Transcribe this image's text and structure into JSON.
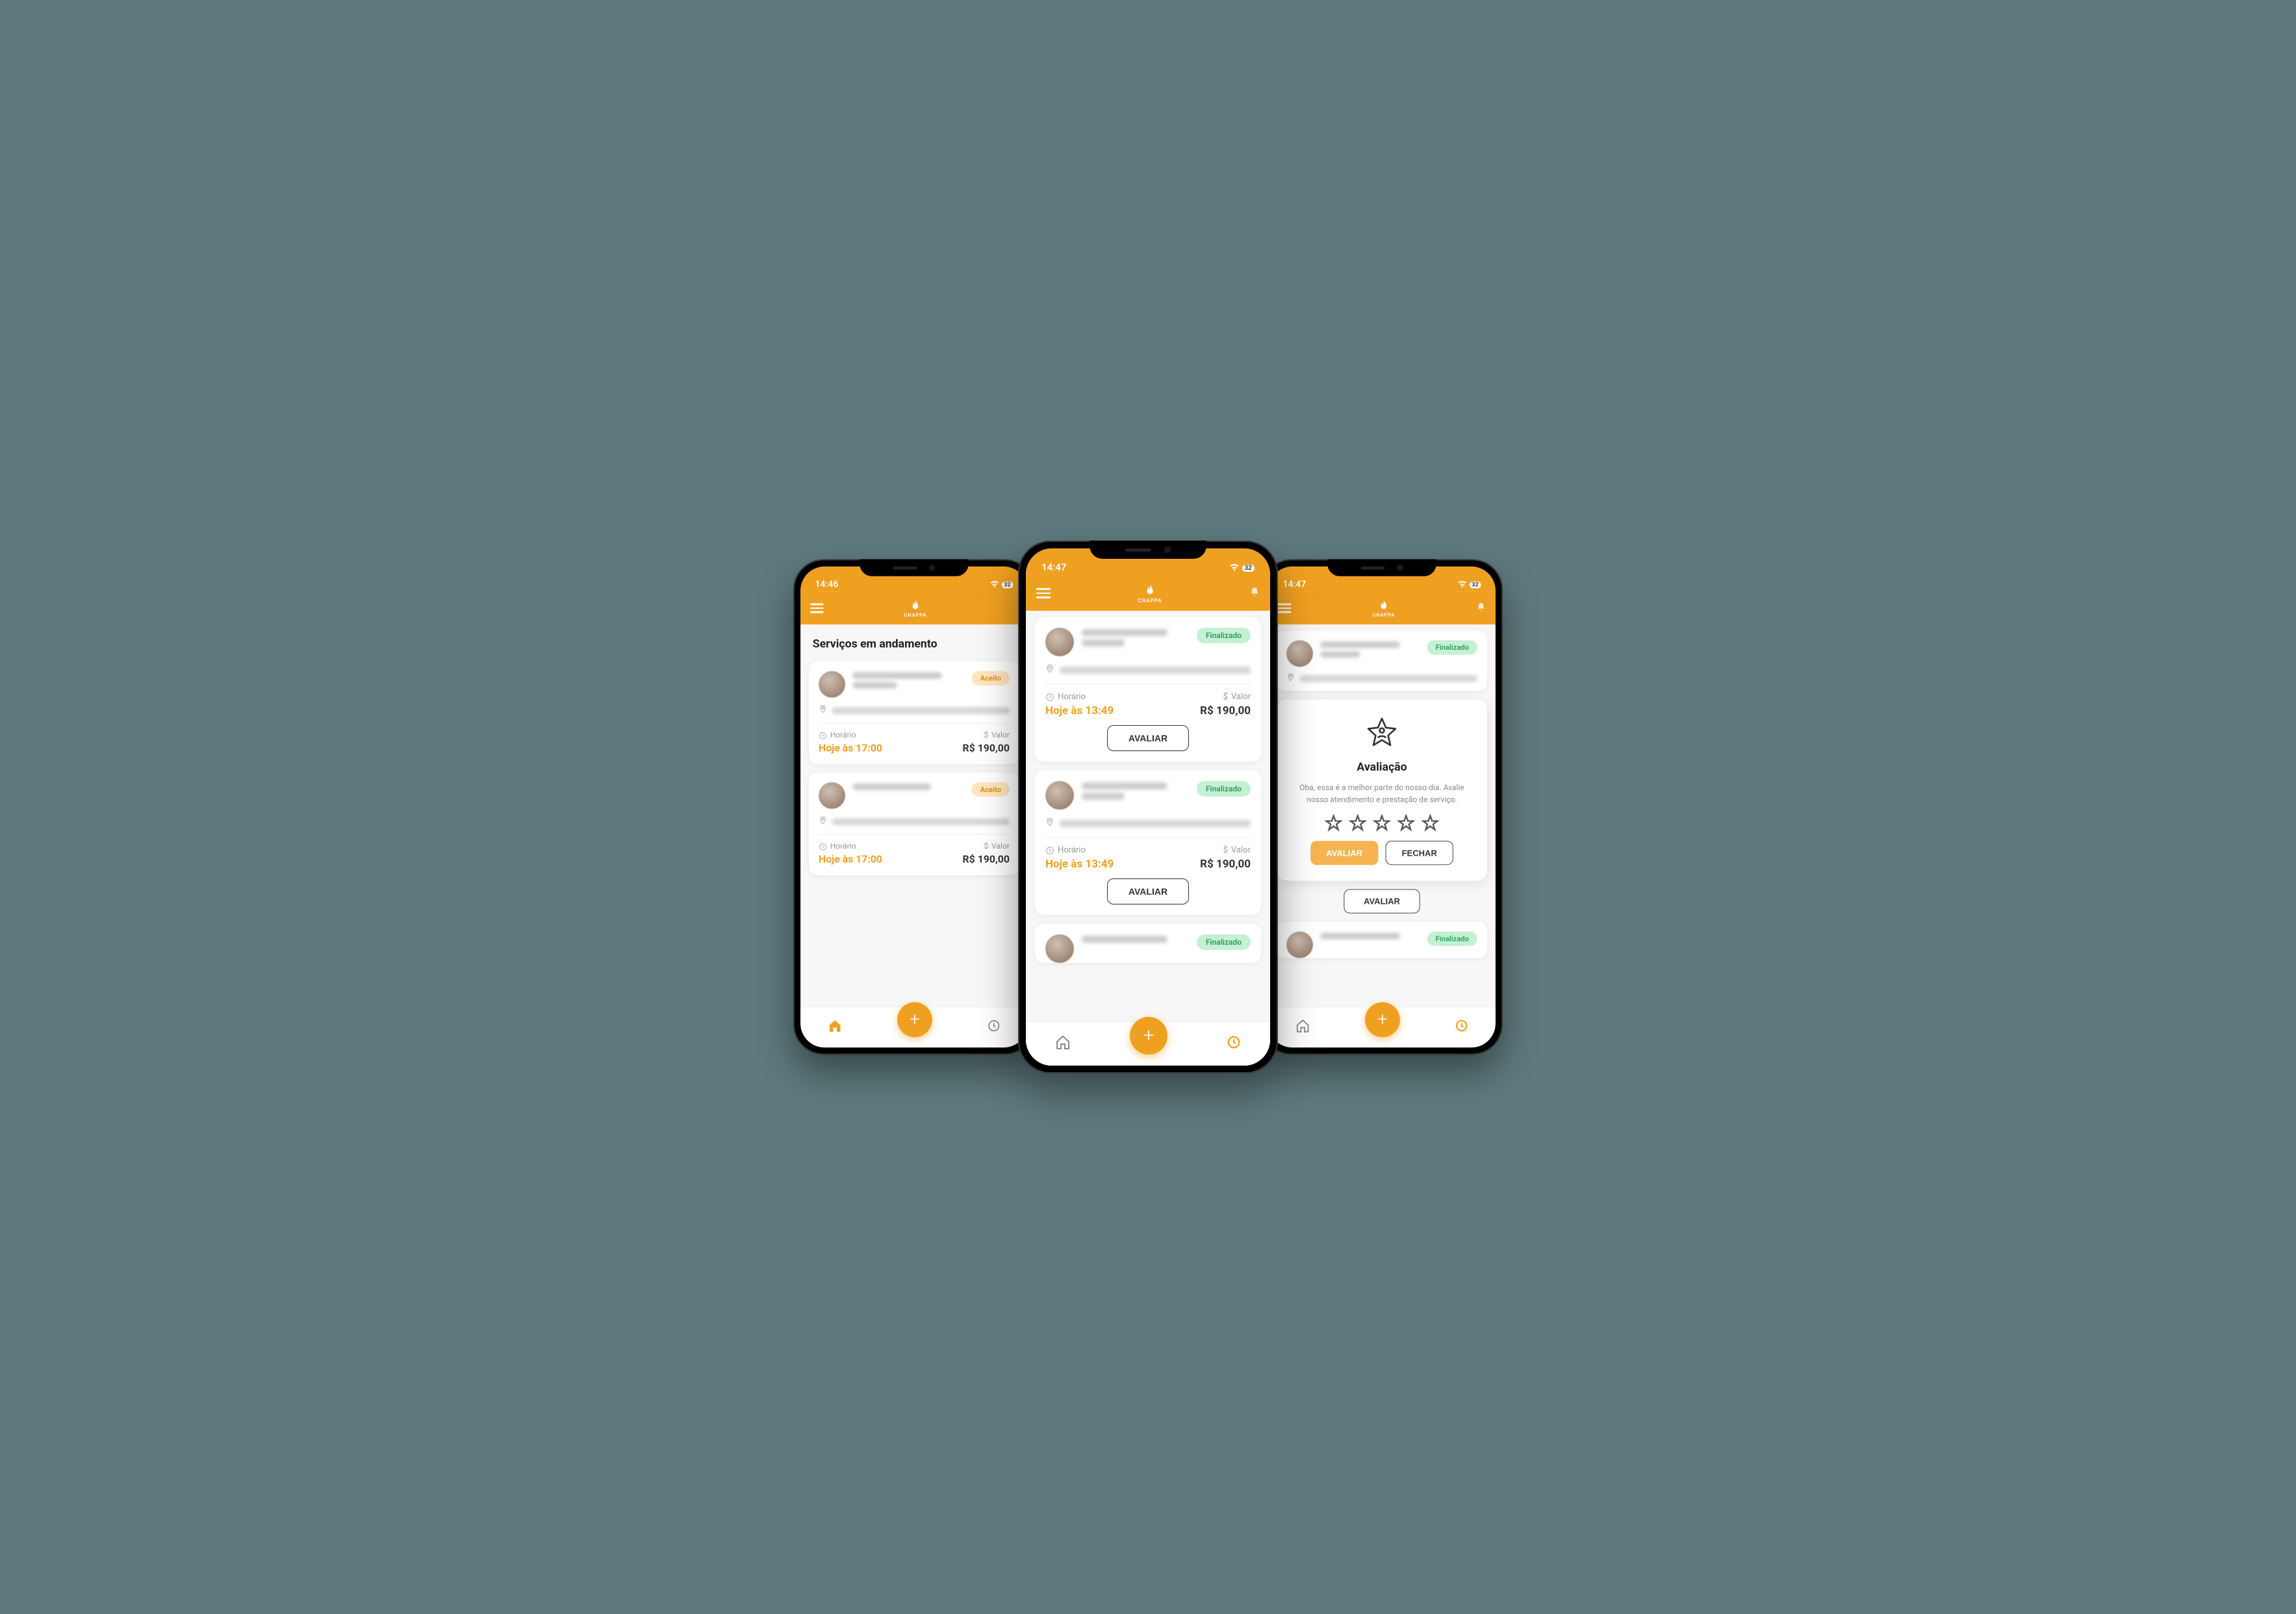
{
  "status_bar": {
    "time_left": "14:46",
    "time_center": "14:47",
    "time_right": "14:47",
    "battery": "32"
  },
  "app": {
    "name": "CHAPPA"
  },
  "screen1": {
    "title": "Serviços em andamento",
    "cards": [
      {
        "badge": "Aceito",
        "schedule_label": "Horário",
        "schedule_value": "Hoje às 17:00",
        "price_label": "Valor",
        "price_value": "R$ 190,00"
      },
      {
        "badge": "Aceito",
        "schedule_label": "Horário",
        "schedule_value": "Hoje às 17:00",
        "price_label": "Valor",
        "price_value": "R$ 190,00"
      }
    ]
  },
  "screen2": {
    "cards": [
      {
        "badge": "Finalizado",
        "schedule_label": "Horário",
        "schedule_value": "Hoje às 13:49",
        "price_label": "Valor",
        "price_value": "R$ 190,00",
        "action": "AVALIAR"
      },
      {
        "badge": "Finalizado",
        "schedule_label": "Horário",
        "schedule_value": "Hoje às 13:49",
        "price_label": "Valor",
        "price_value": "R$ 190,00",
        "action": "AVALIAR"
      },
      {
        "badge": "Finalizado"
      }
    ]
  },
  "screen3": {
    "top_card": {
      "badge": "Finalizado"
    },
    "rating": {
      "title": "Avaliação",
      "body": "Oba, essa é a melhor parte do nosso dia. Avalie nosso atendimento e prestação de serviço.",
      "btn_rate": "AVALIAR",
      "btn_close": "FECHAR",
      "btn_below": "AVALIAR"
    },
    "bottom_card": {
      "badge": "Finalizado"
    }
  },
  "labels": {
    "icon_clock": "Horário",
    "icon_money": "Valor"
  }
}
